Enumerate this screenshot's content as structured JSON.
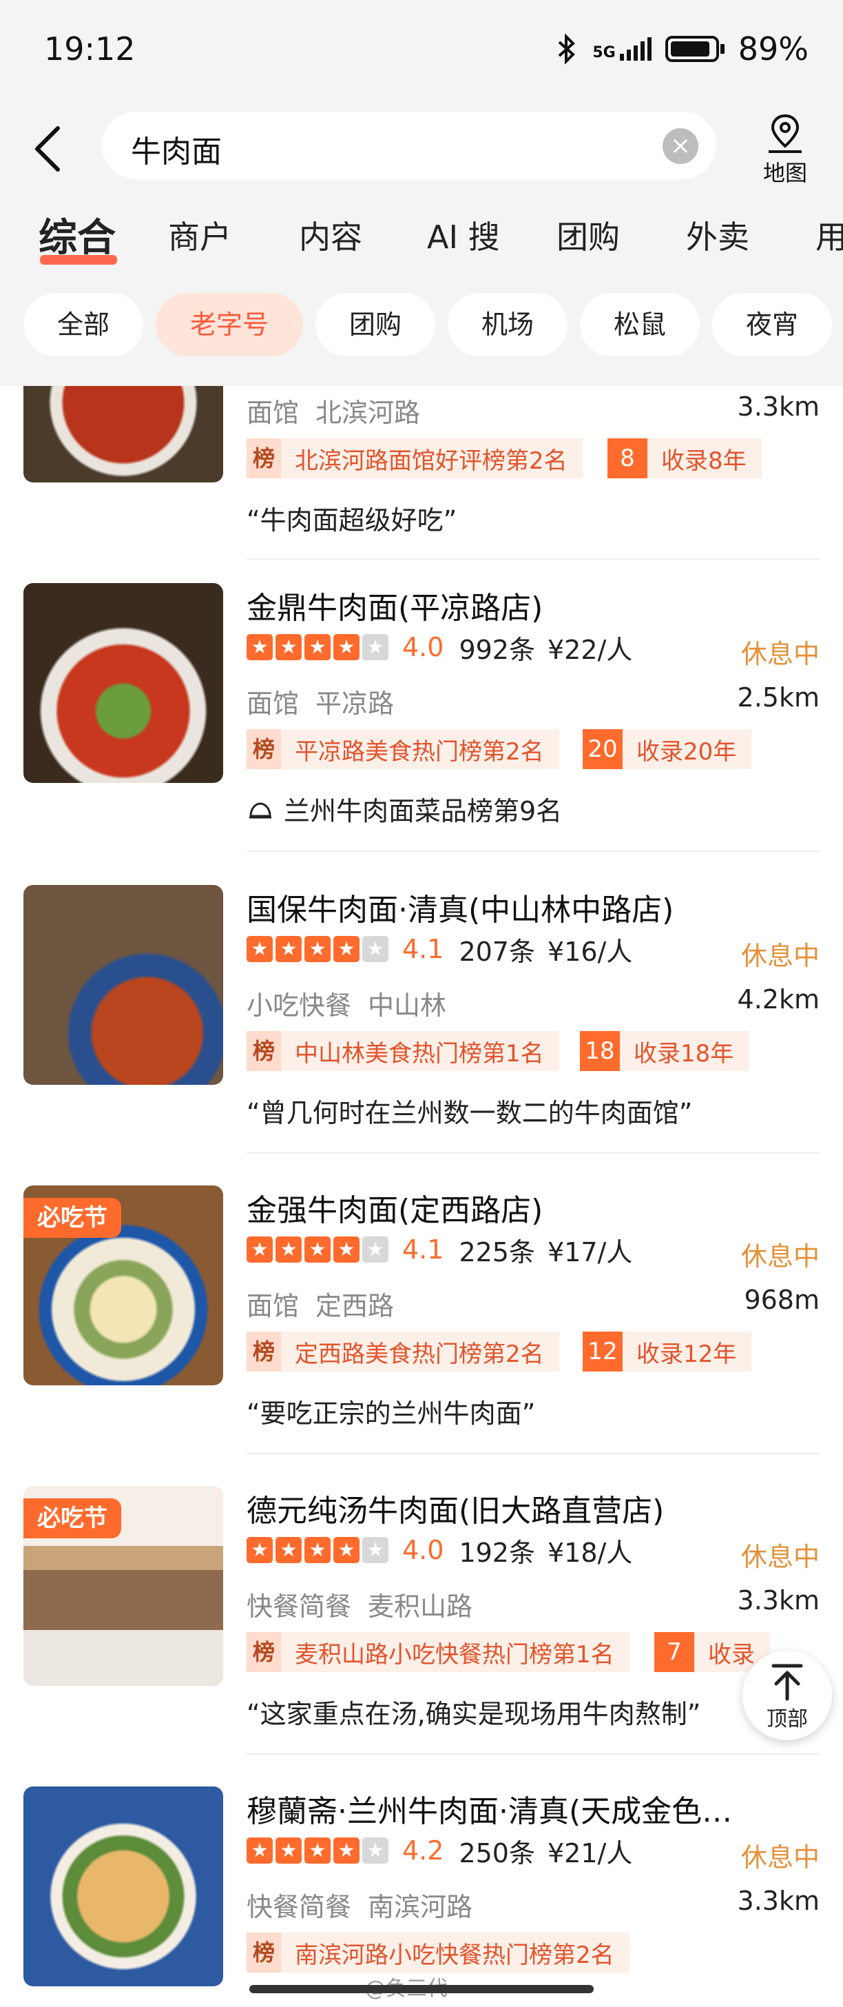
{
  "status": {
    "time": "19:12",
    "network": "5G",
    "battery": "89%"
  },
  "search": {
    "query": "牛肉面",
    "map_label": "地图"
  },
  "tabs": [
    "综合",
    "商户",
    "内容",
    "AI 搜",
    "团购",
    "外卖",
    "用"
  ],
  "chips": [
    "全部",
    "老字号",
    "团购",
    "机场",
    "松鼠",
    "夜宵"
  ],
  "colors": {
    "accent": "#ff5a3c",
    "open_status": "#e3913a"
  },
  "list": {
    "partial": {
      "meta": [
        "面馆",
        "北滨河路"
      ],
      "distance": "3.3km",
      "rank": "北滨河路面馆好评榜第2名",
      "years_num": "8",
      "years_label": "收录8年",
      "quote": "“牛肉面超级好吃”"
    },
    "items": [
      {
        "name": "金鼎牛肉面(平凉路店)",
        "stars": 4,
        "score": "4.0",
        "reviews": "992条",
        "price": "¥22/人",
        "status": "休息中",
        "meta": [
          "面馆",
          "平凉路"
        ],
        "distance": "2.5km",
        "rank": "平凉路美食热门榜第2名",
        "years_num": "20",
        "years_label": "收录20年",
        "dish": "兰州牛肉面菜品榜第9名"
      },
      {
        "name": "国保牛肉面·清真(中山林中路店)",
        "stars": 4,
        "score": "4.1",
        "reviews": "207条",
        "price": "¥16/人",
        "status": "休息中",
        "meta": [
          "小吃快餐",
          "中山林"
        ],
        "distance": "4.2km",
        "rank": "中山林美食热门榜第1名",
        "years_num": "18",
        "years_label": "收录18年",
        "quote": "“曾几何时在兰州数一数二的牛肉面馆”"
      },
      {
        "name": "金强牛肉面(定西路店)",
        "badge": "必吃节",
        "stars": 4,
        "score": "4.1",
        "reviews": "225条",
        "price": "¥17/人",
        "status": "休息中",
        "meta": [
          "面馆",
          "定西路"
        ],
        "distance": "968m",
        "rank": "定西路美食热门榜第2名",
        "years_num": "12",
        "years_label": "收录12年",
        "quote": "“要吃正宗的兰州牛肉面”"
      },
      {
        "name": "德元纯汤牛肉面(旧大路直营店)",
        "badge": "必吃节",
        "stars": 4,
        "score": "4.0",
        "reviews": "192条",
        "price": "¥18/人",
        "status": "休息中",
        "meta": [
          "快餐简餐",
          "麦积山路"
        ],
        "distance": "3.3km",
        "rank": "麦积山路小吃快餐热门榜第1名",
        "years_num": "7",
        "years_label": "收录",
        "quote": "“这家重点在汤,确实是现场用牛肉熬制”"
      },
      {
        "name": "穆蘭斋·兰州牛肉面·清真(天成金色…",
        "stars": 4,
        "score": "4.2",
        "reviews": "250条",
        "price": "¥21/人",
        "status": "休息中",
        "meta": [
          "快餐简餐",
          "南滨河路"
        ],
        "distance": "3.3km",
        "rank": "南滨河路小吃快餐热门榜第2名"
      }
    ]
  },
  "fab": {
    "label": "顶部"
  },
  "rank_icon": "榜",
  "watermark": "@负三代"
}
